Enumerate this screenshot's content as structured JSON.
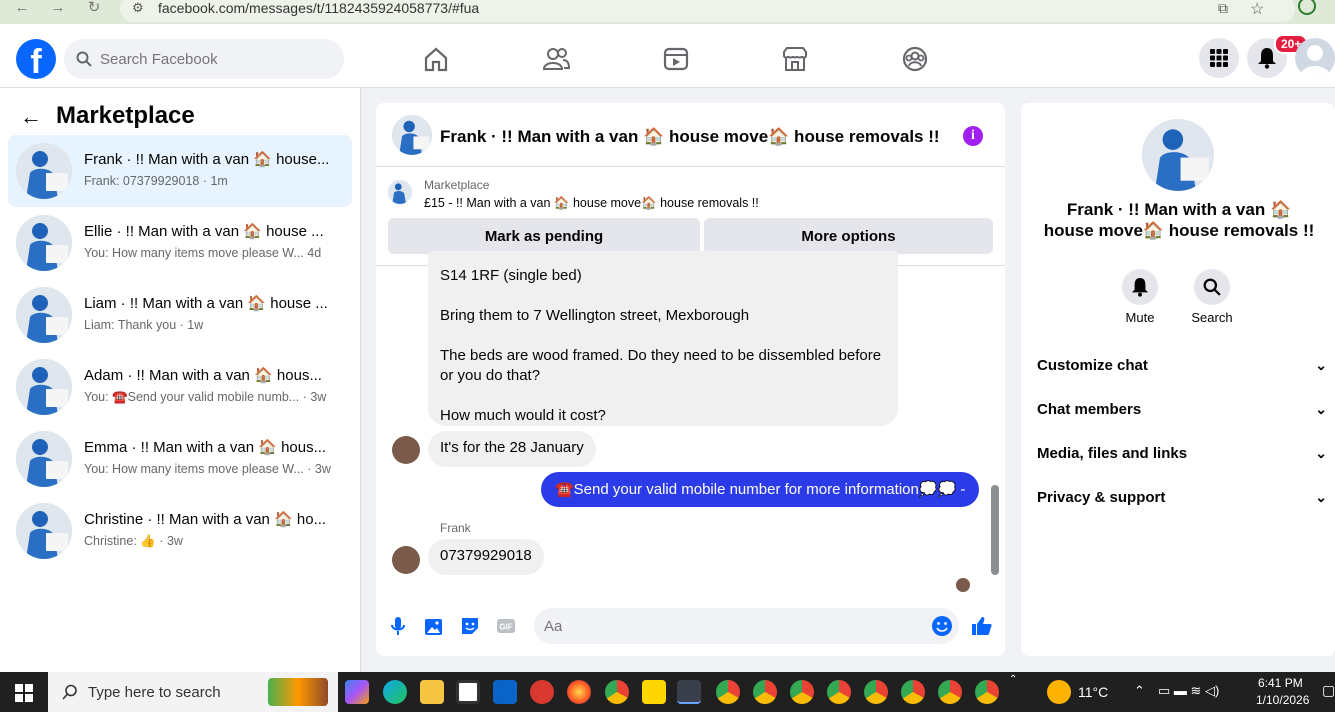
{
  "browser": {
    "url": "facebook.com/messages/t/1182435924058773/#fua"
  },
  "top": {
    "search_placeholder": "Search Facebook",
    "notif_badge": "20+"
  },
  "left": {
    "title": "Marketplace",
    "conversations": [
      {
        "name": "Frank · !! Man with a van 🏠 house...",
        "sub": "Frank: 07379929018 · 1m"
      },
      {
        "name": "Ellie · !! Man with a van 🏠 house ...",
        "sub": "You: How many items move please W...   4d"
      },
      {
        "name": "Liam · !! Man with a van 🏠 house ...",
        "sub": "Liam: Thank you · 1w"
      },
      {
        "name": "Adam · !! Man with a van 🏠 hous...",
        "sub": "You: ☎️Send your valid mobile numb... · 3w"
      },
      {
        "name": "Emma · !! Man with a van 🏠 hous...",
        "sub": "You: How many items move please W... · 3w"
      },
      {
        "name": "Christine · !! Man with a van 🏠 ho...",
        "sub": "Christine: 👍 · 3w"
      }
    ]
  },
  "chat": {
    "title": "Frank · !! Man with a van 🏠 house move🏠 house removals !!",
    "listing_label": "Marketplace",
    "listing_text": "£15 - !! Man with a van 🏠 house move🏠 house removals !!",
    "pending_label": "Mark as pending",
    "more_label": "More options",
    "msg1_line1": "S14 1RF (single bed)",
    "msg1_line2": "Bring them to 7 Wellington street, Mexborough",
    "msg1_line3": "The beds are wood framed. Do they need to be dissembled before or you do that?",
    "msg1_line4": "How much would it cost?",
    "msg2": "It's for the 28 January",
    "msg_out": "☎️Send your valid mobile number for more information💭💭 -",
    "sender_label": "Frank",
    "msg3": "07379929018",
    "composer_placeholder": "Aa"
  },
  "right": {
    "name": "Frank · !! Man with a van 🏠 house move🏠 house removals !!",
    "mute_label": "Mute",
    "search_label": "Search",
    "sections": [
      "Customize chat",
      "Chat members",
      "Media, files and links",
      "Privacy & support"
    ]
  },
  "taskbar": {
    "search_placeholder": "Type here to search",
    "temp": "11°C",
    "time": "6:41 PM",
    "date": "1/10/2026"
  },
  "colors": {
    "brand": "#0866ff",
    "outgoing_bubble": "#2b3be8",
    "info_icon": "#a020f0"
  }
}
